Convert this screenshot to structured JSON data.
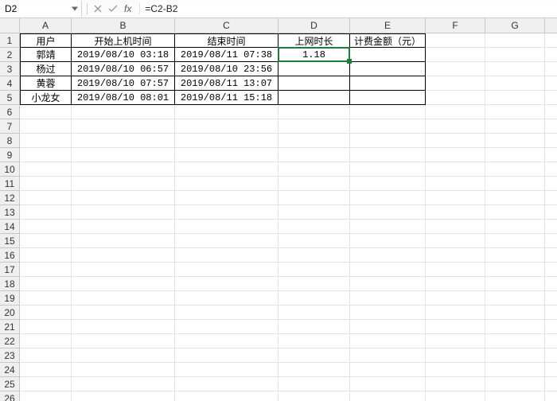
{
  "formula_bar": {
    "name_box": "D2",
    "formula": "=C2-B2"
  },
  "grid": {
    "col_letters": [
      "A",
      "B",
      "C",
      "D",
      "E",
      "F",
      "G"
    ],
    "row_count": 26,
    "active_cell": {
      "row": 2,
      "col": 4
    },
    "headers": {
      "A": "用户",
      "B": "开始上机时间",
      "C": "结束时间",
      "D": "上网时长",
      "E": "计费金额（元）"
    },
    "rows": [
      {
        "A": "郭靖",
        "B": "2019/08/10 03:18",
        "C": "2019/08/11 07:38",
        "D": "1.18",
        "E": ""
      },
      {
        "A": "杨过",
        "B": "2019/08/10 06:57",
        "C": "2019/08/10 23:56",
        "D": "",
        "E": ""
      },
      {
        "A": "黄蓉",
        "B": "2019/08/10 07:57",
        "C": "2019/08/11 13:07",
        "D": "",
        "E": ""
      },
      {
        "A": "小龙女",
        "B": "2019/08/10 08:01",
        "C": "2019/08/11 15:18",
        "D": "",
        "E": ""
      }
    ]
  },
  "chart_data": {
    "type": "table",
    "title": "",
    "columns": [
      "用户",
      "开始上机时间",
      "结束时间",
      "上网时长",
      "计费金额（元）"
    ],
    "rows": [
      [
        "郭靖",
        "2019/08/10 03:18",
        "2019/08/11 07:38",
        1.18,
        null
      ],
      [
        "杨过",
        "2019/08/10 06:57",
        "2019/08/10 23:56",
        null,
        null
      ],
      [
        "黄蓉",
        "2019/08/10 07:57",
        "2019/08/11 13:07",
        null,
        null
      ],
      [
        "小龙女",
        "2019/08/10 08:01",
        "2019/08/11 15:18",
        null,
        null
      ]
    ]
  }
}
